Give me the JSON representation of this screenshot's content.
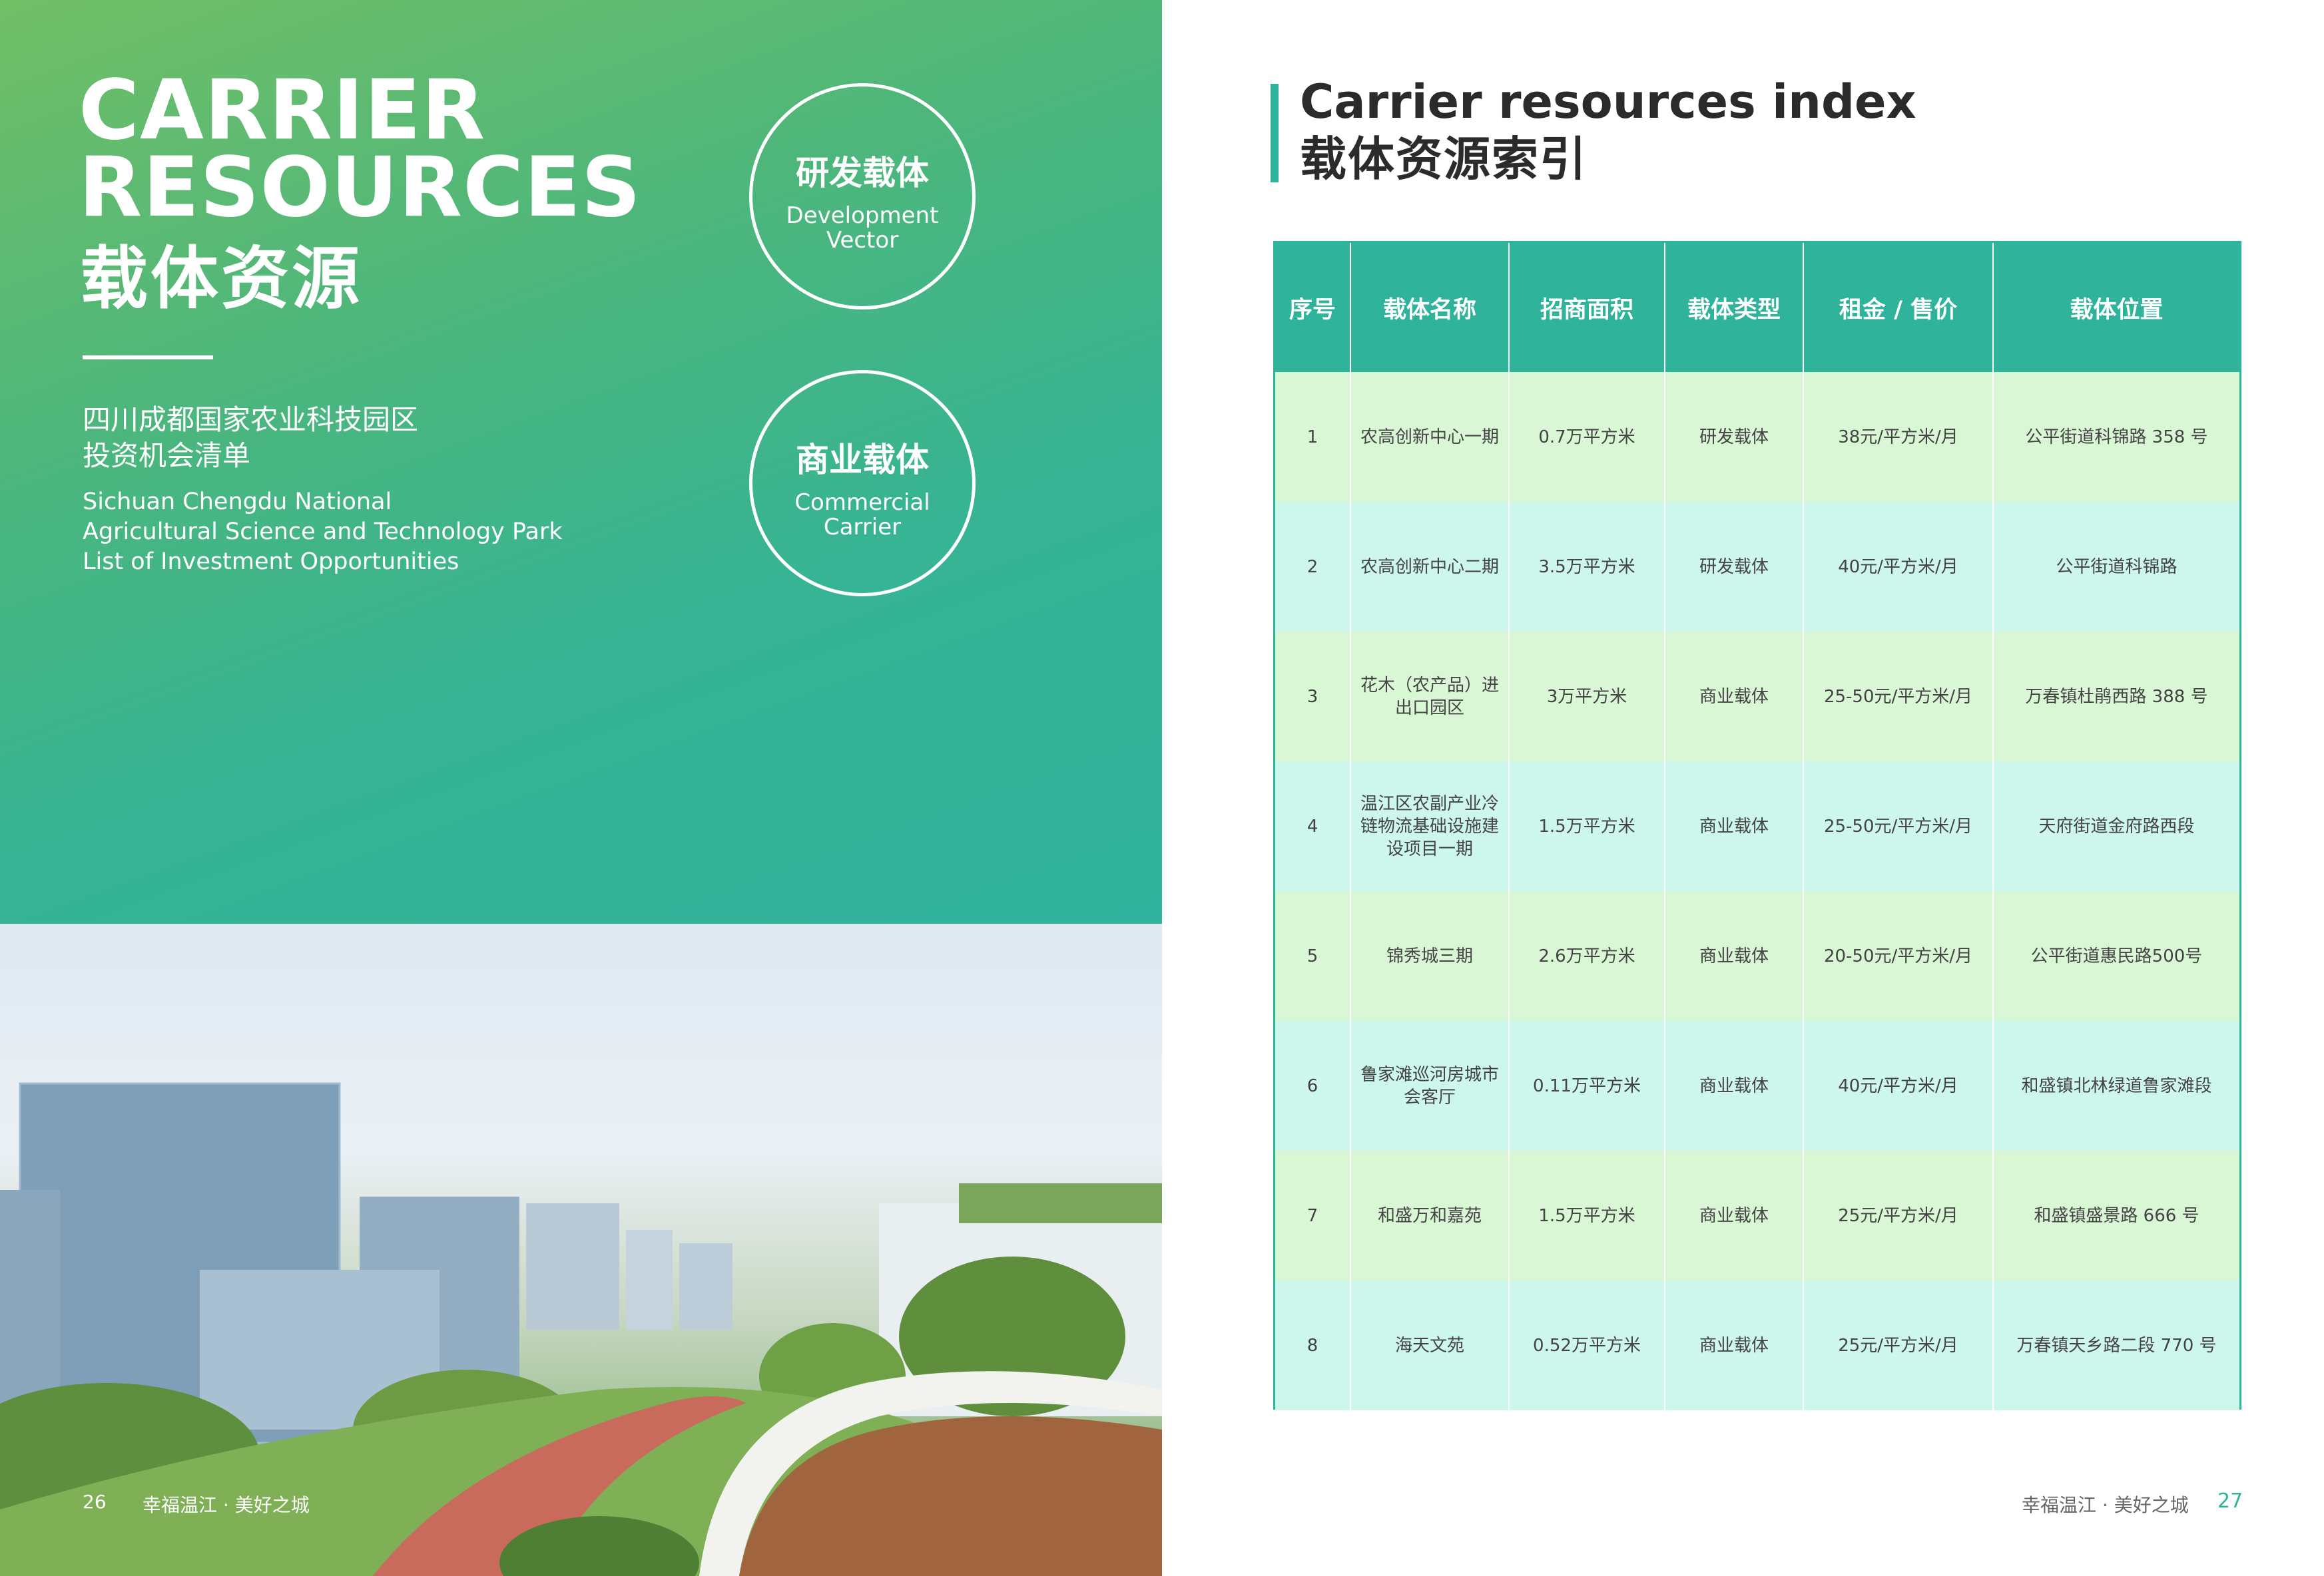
{
  "left_page": {
    "title_en_lines": [
      "CARRIER",
      "RESOURCES"
    ],
    "title_cn": "载体资源",
    "subtitle_cn_lines": [
      "四川成都国家农业科技园区",
      "投资机会清单"
    ],
    "subtitle_en_lines": [
      "Sichuan Chengdu National",
      "Agricultural Science and Technology Park",
      "List of Investment Opportunities"
    ],
    "circles": [
      {
        "cn": "研发载体",
        "en_lines": [
          "Development",
          "Vector"
        ]
      },
      {
        "cn": "商业载体",
        "en_lines": [
          "Commercial",
          "Carrier"
        ]
      }
    ],
    "page_number": "26",
    "slogan": "幸福温江 · 美好之城"
  },
  "right_page": {
    "title_en": "Carrier resources index",
    "title_cn": "载体资源索引",
    "accent_color": "#2fb39a",
    "table": {
      "headers": [
        "序号",
        "载体名称",
        "招商面积",
        "载体类型",
        "租金 / 售价",
        "载体位置"
      ],
      "rows": [
        [
          "1",
          "农高创新中心一期",
          "0.7万平方米",
          "研发载体",
          "38元/平方米/月",
          "公平街道科锦路 358 号"
        ],
        [
          "2",
          "农高创新中心二期",
          "3.5万平方米",
          "研发载体",
          "40元/平方米/月",
          "公平街道科锦路"
        ],
        [
          "3",
          "花木（农产品）进出口园区",
          "3万平方米",
          "商业载体",
          "25-50元/平方米/月",
          "万春镇杜鹃西路 388 号"
        ],
        [
          "4",
          "温江区农副产业冷链物流基础设施建设项目一期",
          "1.5万平方米",
          "商业载体",
          "25-50元/平方米/月",
          "天府街道金府路西段"
        ],
        [
          "5",
          "锦秀城三期",
          "2.6万平方米",
          "商业载体",
          "20-50元/平方米/月",
          "公平街道惠民路500号"
        ],
        [
          "6",
          "鲁家滩巡河房城市会客厅",
          "0.11万平方米",
          "商业载体",
          "40元/平方米/月",
          "和盛镇北林绿道鲁家滩段"
        ],
        [
          "7",
          "和盛万和嘉苑",
          "1.5万平方米",
          "商业载体",
          "25元/平方米/月",
          "和盛镇盛景路 666 号"
        ],
        [
          "8",
          "海天文苑",
          "0.52万平方米",
          "商业载体",
          "25元/平方米/月",
          "万春镇天乡路二段 770 号"
        ]
      ]
    },
    "slogan": "幸福温江 · 美好之城",
    "page_number": "27"
  }
}
